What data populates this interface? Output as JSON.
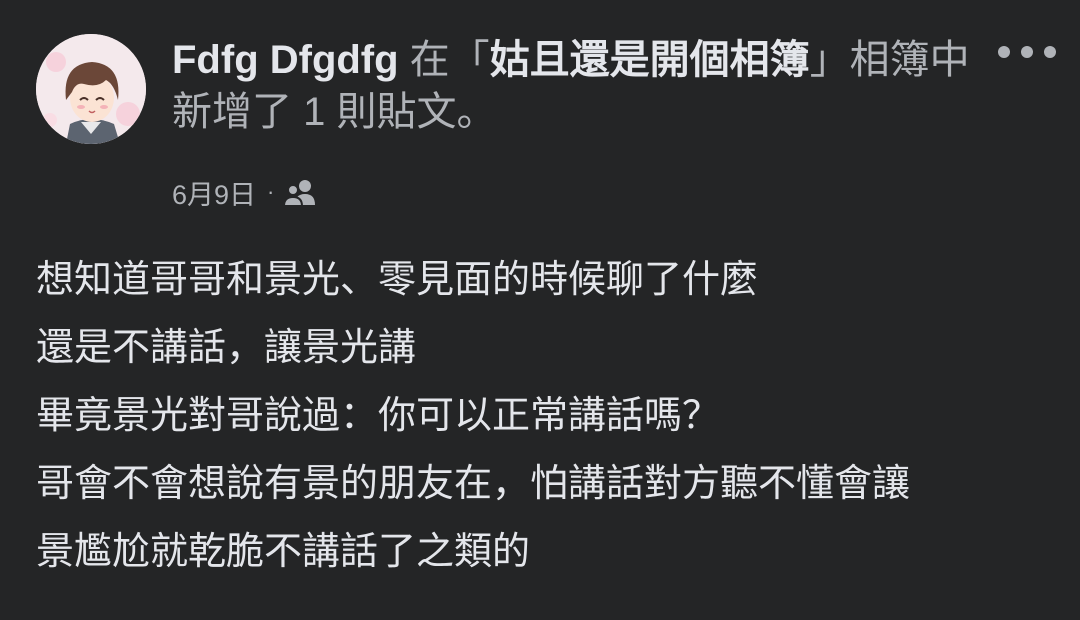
{
  "post": {
    "author": "Fdfg Dfgdfg",
    "action_prefix": " 在「",
    "album_name": "姑且還是開個相簿",
    "action_suffix": "」相簿中新增了 1 則貼文。",
    "date": "6月9日",
    "separator": "·",
    "audience_icon": "friends-icon",
    "more_icon": "more-options-icon",
    "avatar_icon": "anime-avatar",
    "text_lines": [
      "想知道哥哥和景光、零見面的時候聊了什麼",
      "還是不講話，讓景光講",
      "畢竟景光對哥說過：你可以正常講話嗎？",
      "哥會不會想說有景的朋友在，怕講話對方聽不懂會讓",
      "景尷尬就乾脆不講話了之類的"
    ]
  },
  "colors": {
    "background": "#242526",
    "primary_text": "#e4e6eb",
    "secondary_text": "#b0b3b8"
  }
}
